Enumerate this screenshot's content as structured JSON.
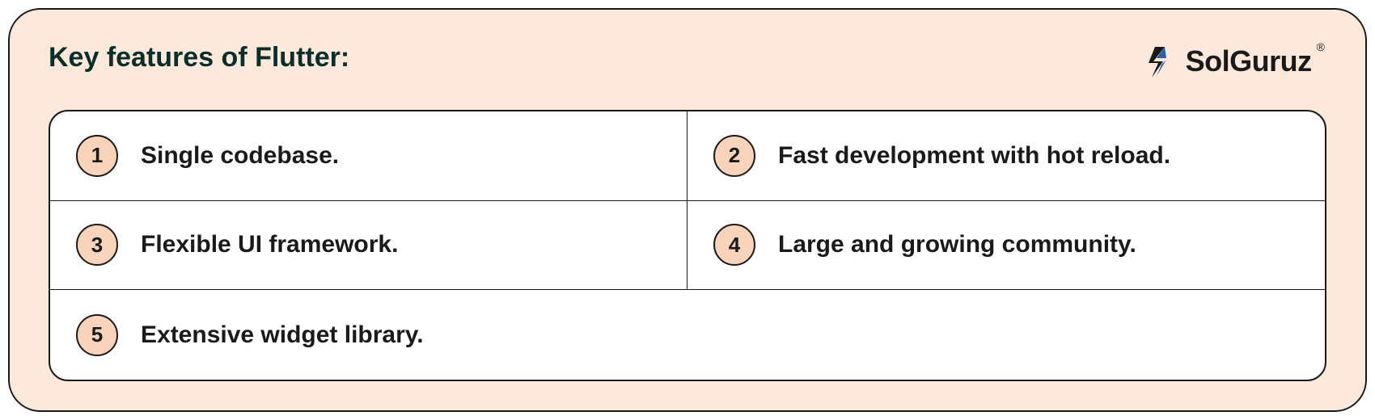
{
  "title": "Key features of Flutter:",
  "logo": {
    "text": "SolGuruz",
    "registered": "®"
  },
  "features": [
    {
      "num": "1",
      "text": "Single codebase."
    },
    {
      "num": "2",
      "text": "Fast development with hot reload."
    },
    {
      "num": "3",
      "text": "Flexible UI framework."
    },
    {
      "num": "4",
      "text": "Large and growing community."
    },
    {
      "num": "5",
      "text": "Extensive widget library."
    }
  ],
  "colors": {
    "cardBg": "#FCE9DC",
    "badgeBg": "#F9D4BB",
    "border": "#1a1a1a",
    "logoBlue": "#2B5FA8"
  }
}
